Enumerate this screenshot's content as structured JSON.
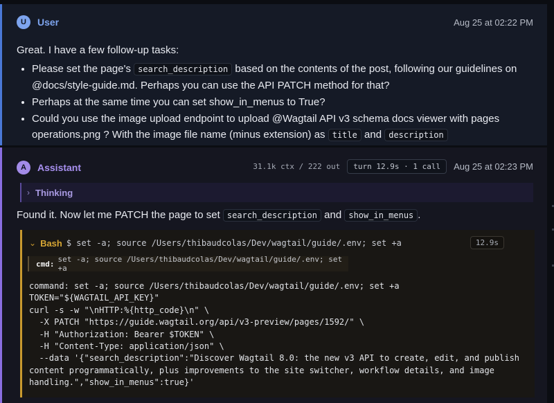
{
  "user_message": {
    "avatar": "U",
    "role": "User",
    "timestamp": "Aug 25 at 02:22 PM",
    "intro": "Great. I have a few follow-up tasks:",
    "tasks": [
      {
        "t1": "Please set the page's ",
        "code1": "search_description",
        "t2": " based on the contents of the post, following our guidelines on @docs/style-guide.md. Perhaps you can use the API PATCH method for that?"
      },
      {
        "t1": "Perhaps at the same time you can set show_in_menus to True?"
      },
      {
        "t1": "Could you use the image upload endpoint to upload @Wagtail API v3 schema docs viewer with pages operations.png ? With the image file name (minus extension) as ",
        "code1": "title",
        "t2": " and ",
        "code2": "description"
      }
    ]
  },
  "assistant_message": {
    "avatar": "A",
    "role": "Assistant",
    "ctx": "31.1k ctx / 222 out",
    "turn_info": "turn 12.9s · 1 call",
    "timestamp": "Aug 25 at 02:23 PM",
    "thinking_label": "Thinking",
    "found_text": {
      "t1": "Found it. Now let me PATCH the page to set ",
      "code1": "search_description",
      "t2": " and ",
      "code2": "show_in_menus",
      "t3": "."
    },
    "tool": {
      "name": "Bash",
      "command": "$ set -a; source /Users/thibaudcolas/Dev/wagtail/guide/.env; set +a",
      "duration": "12.9s",
      "cmd_key": "cmd:",
      "cmd_value": "set -a; source /Users/thibaudcolas/Dev/wagtail/guide/.env; set +a",
      "output": "command: set -a; source /Users/thibaudcolas/Dev/wagtail/guide/.env; set +a\nTOKEN=\"${WAGTAIL_API_KEY}\"\ncurl -s -w \"\\nHTTP:%{http_code}\\n\" \\\n  -X PATCH \"https://guide.wagtail.org/api/v3-preview/pages/1592/\" \\\n  -H \"Authorization: Bearer $TOKEN\" \\\n  -H \"Content-Type: application/json\" \\\n  --data '{\"search_description\":\"Discover Wagtail 8.0: the new v3 API to create, edit, and publish content programmatically, plus improvements to the site switcher, workflow details, and image handling.\",\"show_in_menus\":true}'"
    }
  },
  "colors": {
    "user_accent": "#4a78d6",
    "assistant_accent": "#8a6ee0",
    "tool_accent": "#c99a2e"
  }
}
